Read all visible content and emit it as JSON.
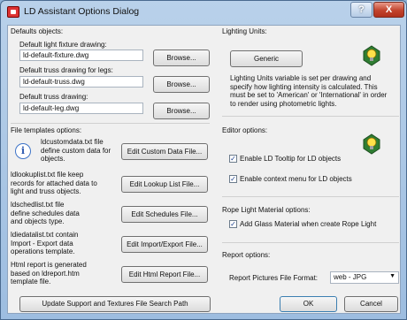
{
  "window": {
    "title": "LD Assistant Options Dialog",
    "help_label": "?",
    "close_label": "X"
  },
  "defaults": {
    "section_label": "Defaults objects:",
    "light_fixture": {
      "label": "Default light fixture drawing:",
      "value": "ld-default-fixture.dwg",
      "browse_label": "Browse..."
    },
    "truss_legs": {
      "label": "Default truss drawing for legs:",
      "value": "ld-default-truss.dwg",
      "browse_label": "Browse..."
    },
    "truss": {
      "label": "Default truss drawing:",
      "value": "ld-default-leg.dwg",
      "browse_label": "Browse..."
    }
  },
  "file_templates": {
    "section_label": "File templates options:",
    "items": [
      {
        "description": "ldcustomdata.txt file define custom data for objects.",
        "button_label": "Edit Custom Data File..."
      },
      {
        "description": "ldlookuplist.txt file keep records for attached data to light and truss objects.",
        "button_label": "Edit Lookup List File..."
      },
      {
        "description": "ldschedlist.txt file define schedules data and objects type.",
        "button_label": "Edit Schedules File..."
      },
      {
        "description": "ldiedatalist.txt contain Import - Export data operations template.",
        "button_label": "Edit Import/Export File..."
      },
      {
        "description": "Html report is generated based on ldreport.htm template file.",
        "button_label": "Edit Html Report File..."
      }
    ]
  },
  "lighting_units": {
    "section_label": "Lighting Units:",
    "button_label": "Generic",
    "help_text": "Lighting Units variable is set per drawing and specify how lighting intensity is calculated. This must be set to 'American' or 'International' in order to render using photometric lights."
  },
  "editor": {
    "section_label": "Editor options:",
    "tooltip_label": "Enable LD Tooltip for LD objects",
    "tooltip_checked": true,
    "context_menu_label": "Enable context menu for LD objects",
    "context_menu_checked": true
  },
  "rope_light": {
    "section_label": "Rope Light Material options:",
    "glass_label": "Add Glass Material when create Rope Light",
    "glass_checked": true
  },
  "report": {
    "section_label": "Report options:",
    "format_label": "Report Pictures File Format:",
    "format_value": "web - JPG"
  },
  "footer": {
    "update_paths_label": "Update Support and Textures File Search Path",
    "ok_label": "OK",
    "cancel_label": "Cancel"
  },
  "colors": {
    "title_bar": "#b9d1ea",
    "close_button": "#c2432d",
    "dialog_body": "#f0f0f0",
    "checkbox_mark": "#1b3f8f"
  },
  "icons": [
    "app-icon",
    "info-icon",
    "lightbulb-icon",
    "checkmark-icon",
    "dropdown-arrow-icon"
  ]
}
